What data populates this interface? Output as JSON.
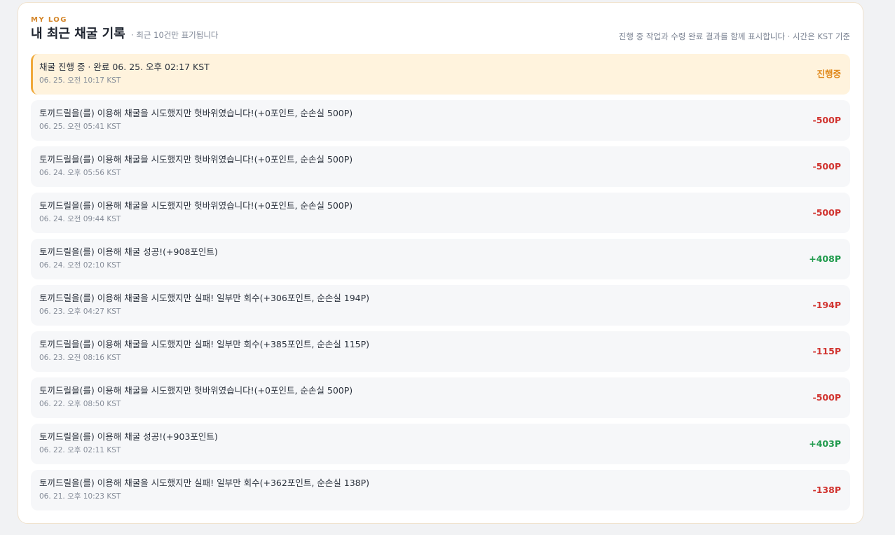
{
  "header": {
    "eyebrow": "MY LOG",
    "title": "내 최근 채굴 기록",
    "subtitle": "· 최근 10건만 표기됩니다",
    "hint": "진행 중 작업과 수령 완료 결과를 함께 표시합니다 · 시간은 KST 기준"
  },
  "colors": {
    "accent": "#d4862a",
    "pending_bg": "#fff3dd",
    "pending_border": "#f0a93a",
    "negative": "#d1332f",
    "positive": "#1f9a4c"
  },
  "logs": [
    {
      "status": "pending",
      "message": "채굴 진행 중 · 완료 06. 25. 오후 02:17 KST",
      "time": "06. 25. 오전 10:17 KST",
      "amount": "진행중"
    },
    {
      "status": "negative",
      "message": "토끼드릴을(를) 이용해 채굴을 시도했지만 헛바위였습니다!(+0포인트, 순손실 500P)",
      "time": "06. 25. 오전 05:41 KST",
      "amount": "-500P"
    },
    {
      "status": "negative",
      "message": "토끼드릴을(를) 이용해 채굴을 시도했지만 헛바위였습니다!(+0포인트, 순손실 500P)",
      "time": "06. 24. 오후 05:56 KST",
      "amount": "-500P"
    },
    {
      "status": "negative",
      "message": "토끼드릴을(를) 이용해 채굴을 시도했지만 헛바위였습니다!(+0포인트, 순손실 500P)",
      "time": "06. 24. 오전 09:44 KST",
      "amount": "-500P"
    },
    {
      "status": "positive",
      "message": "토끼드릴을(를) 이용해 채굴 성공!(+908포인트)",
      "time": "06. 24. 오전 02:10 KST",
      "amount": "+408P"
    },
    {
      "status": "negative",
      "message": "토끼드릴을(를) 이용해 채굴을 시도했지만 실패! 일부만 회수(+306포인트, 순손실 194P)",
      "time": "06. 23. 오후 04:27 KST",
      "amount": "-194P"
    },
    {
      "status": "negative",
      "message": "토끼드릴을(를) 이용해 채굴을 시도했지만 실패! 일부만 회수(+385포인트, 순손실 115P)",
      "time": "06. 23. 오전 08:16 KST",
      "amount": "-115P"
    },
    {
      "status": "negative",
      "message": "토끼드릴을(를) 이용해 채굴을 시도했지만 헛바위였습니다!(+0포인트, 순손실 500P)",
      "time": "06. 22. 오후 08:50 KST",
      "amount": "-500P"
    },
    {
      "status": "positive",
      "message": "토끼드릴을(를) 이용해 채굴 성공!(+903포인트)",
      "time": "06. 22. 오후 02:11 KST",
      "amount": "+403P"
    },
    {
      "status": "negative",
      "message": "토끼드릴을(를) 이용해 채굴을 시도했지만 실패! 일부만 회수(+362포인트, 순손실 138P)",
      "time": "06. 21. 오후 10:23 KST",
      "amount": "-138P"
    }
  ]
}
